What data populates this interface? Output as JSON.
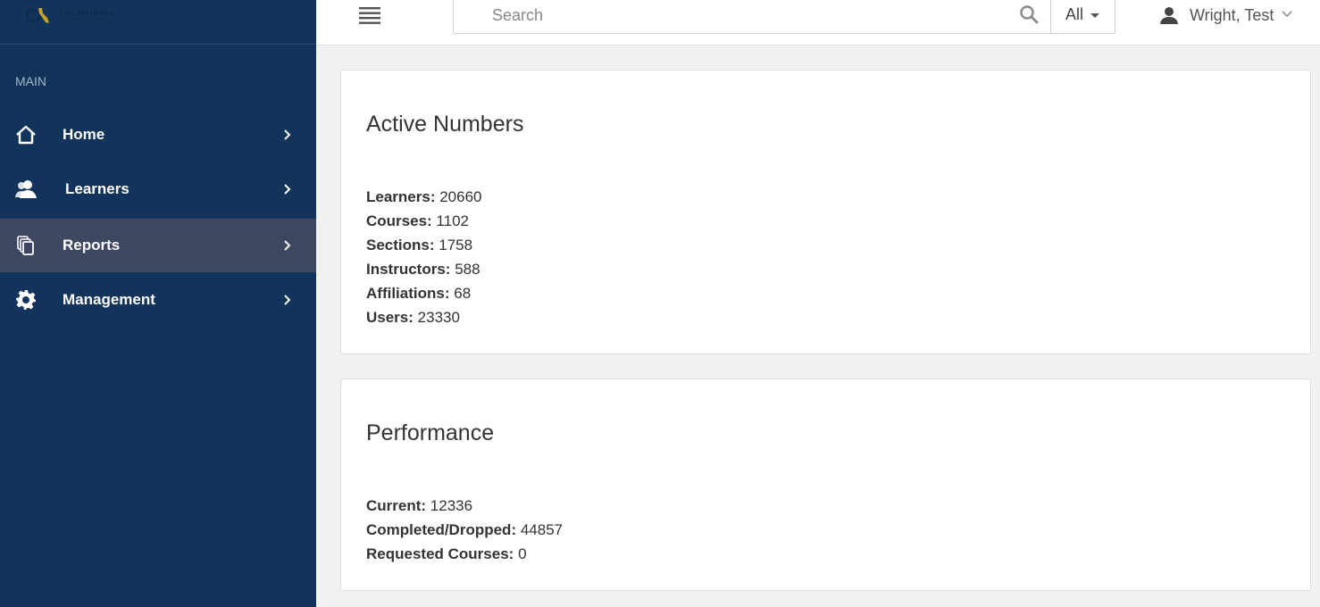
{
  "sidebar": {
    "logo": {
      "title": "CALIFORNIA",
      "subtitle": "Child Welfare Training"
    },
    "section_label": "MAIN",
    "items": [
      {
        "label": "Home",
        "icon": "home-icon",
        "active": false
      },
      {
        "label": "Learners",
        "icon": "users-icon",
        "active": false
      },
      {
        "label": "Reports",
        "icon": "copy-icon",
        "active": true
      },
      {
        "label": "Management",
        "icon": "gear-icon",
        "active": false
      }
    ]
  },
  "topbar": {
    "search": {
      "placeholder": "Search",
      "value": ""
    },
    "scope": {
      "selected": "All"
    },
    "user": {
      "name": "Wright, Test"
    }
  },
  "cards": {
    "active_numbers": {
      "title": "Active Numbers",
      "stats": [
        {
          "label": "Learners:",
          "value": "20660"
        },
        {
          "label": "Courses:",
          "value": "1102"
        },
        {
          "label": "Sections:",
          "value": "1758"
        },
        {
          "label": "Instructors:",
          "value": "588"
        },
        {
          "label": "Affiliations:",
          "value": "68"
        },
        {
          "label": "Users:",
          "value": "23330"
        }
      ]
    },
    "performance": {
      "title": "Performance",
      "stats": [
        {
          "label": "Current:",
          "value": "12336"
        },
        {
          "label": "Completed/Dropped:",
          "value": "44857"
        },
        {
          "label": "Requested Courses:",
          "value": "0"
        }
      ]
    }
  }
}
